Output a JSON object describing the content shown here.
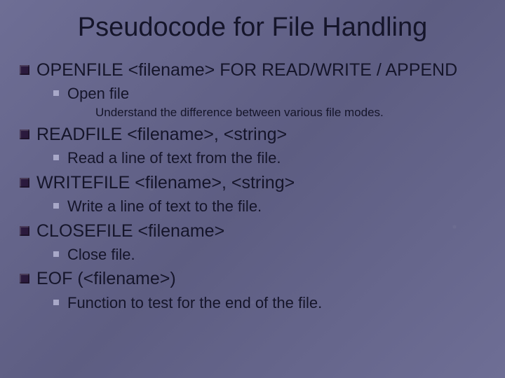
{
  "title": "Pseudocode for File Handling",
  "items": [
    {
      "level": 1,
      "text": "OPENFILE <filename> FOR READ/WRITE / APPEND"
    },
    {
      "level": 2,
      "text": "Open file"
    },
    {
      "level": 3,
      "text": "Understand the difference between various file modes."
    },
    {
      "level": 1,
      "text": "READFILE <filename>, <string>"
    },
    {
      "level": 2,
      "text": "Read a line of text from the file."
    },
    {
      "level": 1,
      "text": "WRITEFILE <filename>, <string>"
    },
    {
      "level": 2,
      "text": "Write a line of text to the file."
    },
    {
      "level": 1,
      "text": "CLOSEFILE <filename>"
    },
    {
      "level": 2,
      "text": "Close file."
    },
    {
      "level": 1,
      "text": "EOF (<filename>)"
    },
    {
      "level": 2,
      "text": "Function to test for the end of the file."
    }
  ]
}
